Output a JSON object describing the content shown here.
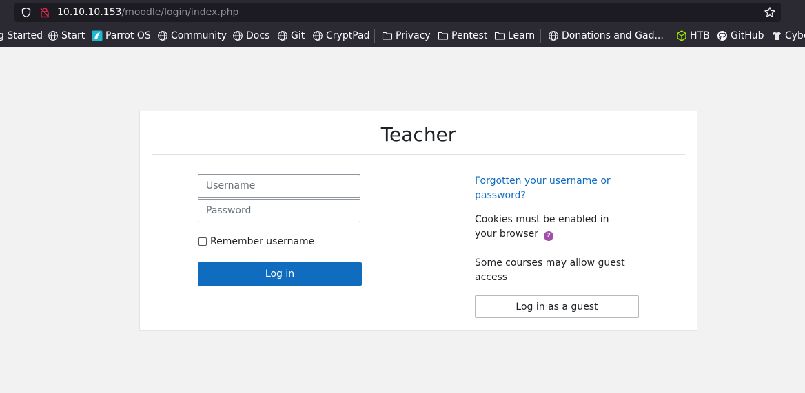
{
  "browser": {
    "url_host": "10.10.10.153",
    "url_path": "/moodle/login/index.php",
    "bookmarks": [
      {
        "label": "g Started",
        "icon": "none"
      },
      {
        "label": "Start",
        "icon": "globe-icon"
      },
      {
        "label": "Parrot OS",
        "icon": "parrot-icon"
      },
      {
        "label": "Community",
        "icon": "globe-icon"
      },
      {
        "label": "Docs",
        "icon": "globe-icon"
      },
      {
        "label": "Git",
        "icon": "globe-icon"
      },
      {
        "label": "CryptPad",
        "icon": "globe-icon"
      },
      {
        "label": "Privacy",
        "icon": "folder-icon"
      },
      {
        "label": "Pentest",
        "icon": "folder-icon"
      },
      {
        "label": "Learn",
        "icon": "folder-icon"
      },
      {
        "label": "Donations and Gad...",
        "icon": "globe-icon"
      },
      {
        "label": "HTB",
        "icon": "htb-icon"
      },
      {
        "label": "GitHub",
        "icon": "github-icon"
      },
      {
        "label": "Cybe",
        "icon": "shirt-icon"
      }
    ]
  },
  "login": {
    "title": "Teacher",
    "username_placeholder": "Username",
    "password_placeholder": "Password",
    "remember_label": "Remember username",
    "login_button": "Log in",
    "forgot_link": "Forgotten your username or password?",
    "cookies_text": "Cookies must be enabled in your browser",
    "guest_text": "Some courses may allow guest access",
    "guest_button": "Log in as a guest"
  },
  "colors": {
    "primary": "#0f6cbf",
    "help_icon": "#a34ea8",
    "page_bg": "#f2f2f2",
    "chrome_bg": "#2b2a33"
  }
}
